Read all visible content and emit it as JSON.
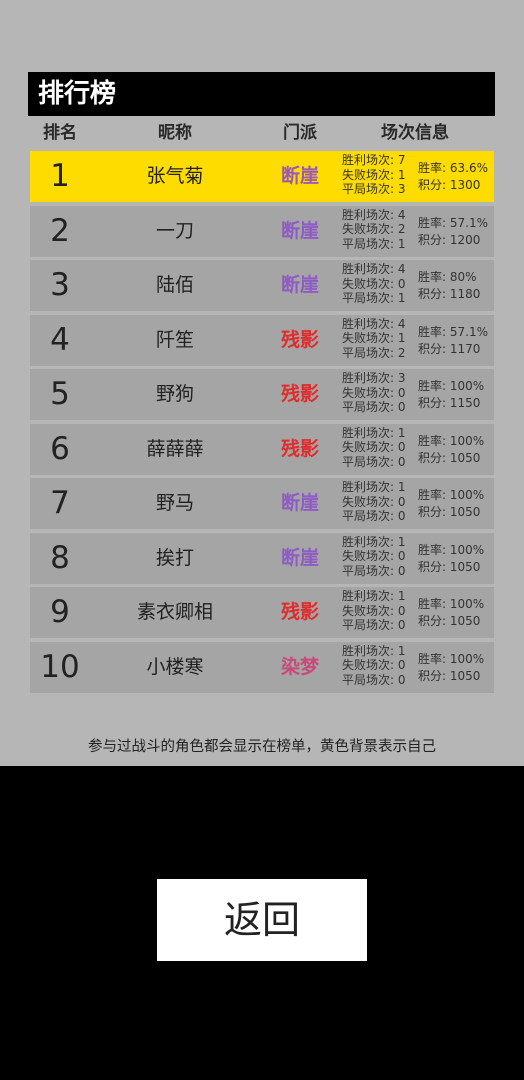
{
  "title": "排行榜",
  "headers": {
    "rank": "排名",
    "nick": "昵称",
    "sect": "门派",
    "info": "场次信息"
  },
  "labels": {
    "win": "胜利场次",
    "lose": "失败场次",
    "draw": "平局场次",
    "rate": "胜率",
    "score": "积分"
  },
  "sect_colors": {
    "断崖": "#8d5cc4",
    "残影": "#e02c2c",
    "染梦": "#c84a7a"
  },
  "highlight_sect_color": "#9a5ab8",
  "rows": [
    {
      "rank": "1",
      "nick": "张气菊",
      "sect": "断崖",
      "win": "7",
      "lose": "1",
      "draw": "3",
      "rate": "63.6%",
      "score": "1300",
      "me": true
    },
    {
      "rank": "2",
      "nick": "一刀",
      "sect": "断崖",
      "win": "4",
      "lose": "2",
      "draw": "1",
      "rate": "57.1%",
      "score": "1200"
    },
    {
      "rank": "3",
      "nick": "陆佰",
      "sect": "断崖",
      "win": "4",
      "lose": "0",
      "draw": "1",
      "rate": "80%",
      "score": "1180"
    },
    {
      "rank": "4",
      "nick": "阡笙",
      "sect": "残影",
      "win": "4",
      "lose": "1",
      "draw": "2",
      "rate": "57.1%",
      "score": "1170"
    },
    {
      "rank": "5",
      "nick": "野狗",
      "sect": "残影",
      "win": "3",
      "lose": "0",
      "draw": "0",
      "rate": "100%",
      "score": "1150"
    },
    {
      "rank": "6",
      "nick": "薛薛薛",
      "sect": "残影",
      "win": "1",
      "lose": "0",
      "draw": "0",
      "rate": "100%",
      "score": "1050"
    },
    {
      "rank": "7",
      "nick": "野马",
      "sect": "断崖",
      "win": "1",
      "lose": "0",
      "draw": "0",
      "rate": "100%",
      "score": "1050"
    },
    {
      "rank": "8",
      "nick": "挨打",
      "sect": "断崖",
      "win": "1",
      "lose": "0",
      "draw": "0",
      "rate": "100%",
      "score": "1050"
    },
    {
      "rank": "9",
      "nick": "素衣卿相",
      "sect": "残影",
      "win": "1",
      "lose": "0",
      "draw": "0",
      "rate": "100%",
      "score": "1050"
    },
    {
      "rank": "10",
      "nick": "小楼寒",
      "sect": "染梦",
      "win": "1",
      "lose": "0",
      "draw": "0",
      "rate": "100%",
      "score": "1050"
    }
  ],
  "footnote": "参与过战斗的角色都会显示在榜单，黄色背景表示自己",
  "back_label": "返回"
}
